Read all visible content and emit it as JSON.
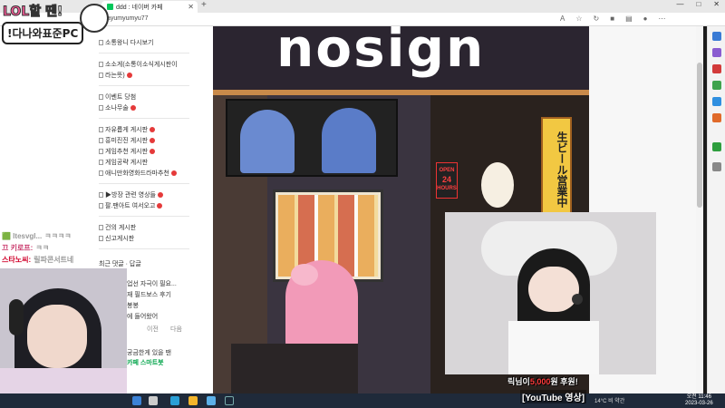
{
  "browser": {
    "tab_title": "ddd : 네이버 카페",
    "url": "ayumyumyu77",
    "window_controls": [
      "—",
      "□",
      "✕"
    ]
  },
  "cafe_menu": {
    "groups": [
      {
        "items": [
          {
            "label": "소통왕니 다시보기",
            "new": false
          }
        ]
      },
      {
        "items": [
          {
            "label": "소소게(소통이소식게시판이",
            "new": false
          },
          {
            "label": "라는뜻)",
            "new": true
          }
        ]
      },
      {
        "items": [
          {
            "label": "이벤트 당첨",
            "new": false
          },
          {
            "label": "소나무술",
            "new": true
          }
        ]
      },
      {
        "items": [
          {
            "label": "자유롭게 게시판",
            "new": true
          },
          {
            "label": "흥미진진 게시판",
            "new": true
          },
          {
            "label": "게임추천 게시판",
            "new": true
          },
          {
            "label": "게임공략 게시판",
            "new": false
          },
          {
            "label": "애니만화영화드라마추천",
            "new": true
          }
        ]
      },
      {
        "items": [
          {
            "label": "▶방장 관련 영상들",
            "new": true
          },
          {
            "label": "팔.팬아트 여서오고",
            "new": true
          }
        ]
      },
      {
        "items": [
          {
            "label": "건의 게시판",
            "new": false
          },
          {
            "label": "신고게시판",
            "new": false
          }
        ]
      }
    ],
    "recent_heading": "최근 댓글 · 답글",
    "recent_items": [
      "업선 자극이 필요...",
      "재 필드보스 후기",
      "봉봉",
      "에 들어왔어"
    ],
    "pager": [
      "이전",
      "다음"
    ],
    "promo": [
      "궁금한게 있을 땐",
      "카페 스마트봇"
    ]
  },
  "stream": {
    "logo_top_1": "LOL",
    "logo_top_2": "할 땐!",
    "logo_bottom": "!다나와표준PC",
    "chat": [
      {
        "name": "🟩 ltesvgl...",
        "message": "ㅋㅋㅋㅋ",
        "style": "a"
      },
      {
        "name": "끄 키로프:",
        "message": "ㅋㅋ",
        "style": "b"
      },
      {
        "name": "스타노씨:",
        "message": "릴파콘서트네",
        "style": "c"
      }
    ],
    "caption_pre": "릭님이",
    "caption_hl": "5,000",
    "caption_post": "원 후원!",
    "source_label": "[YouTube 영상]"
  },
  "storefront": {
    "sign_text": "nosign",
    "open_sign": [
      "OPEN",
      "24",
      "HOURS"
    ],
    "vertical_banner": "生ビール営業中"
  },
  "taskbar": {
    "weather": "14°C 비 약간",
    "time": "오전 11:46",
    "date": "2023-03-26"
  },
  "colors": {
    "accent_green": "#03c75a",
    "new_badge": "#e53a3a",
    "taskbar": "#1f2a3a"
  }
}
